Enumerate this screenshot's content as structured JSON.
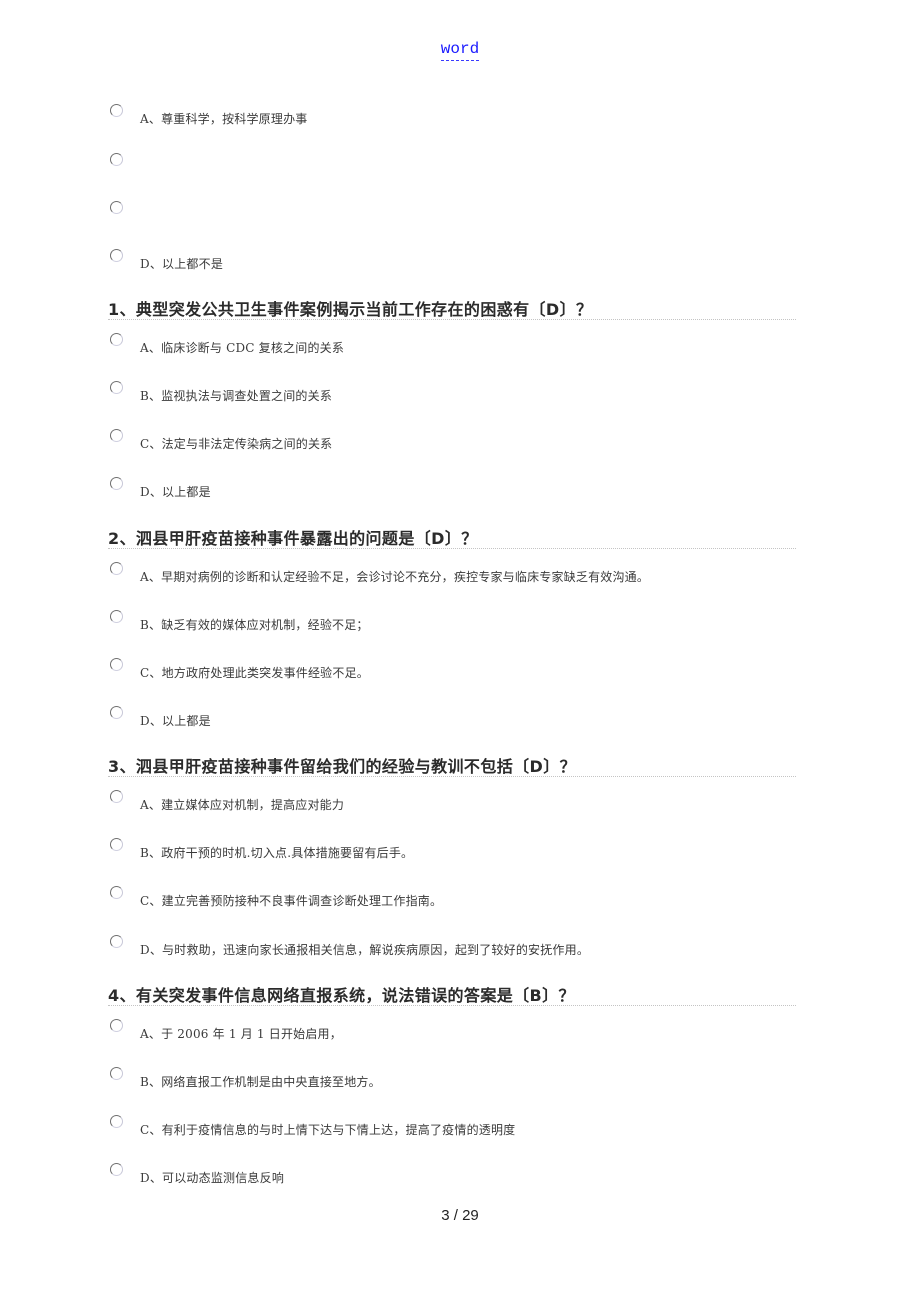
{
  "header": {
    "link_text": "word",
    "link_color": "#1a1aff"
  },
  "icons": {
    "option_marker": "radio-button-icon"
  },
  "preceding_options": [
    {
      "label": "A、尊重科学，按科学原理办事"
    },
    {
      "label": ""
    },
    {
      "label": ""
    },
    {
      "label": "D、以上都不是"
    }
  ],
  "questions": [
    {
      "title": "1、典型突发公共卫生事件案例揭示当前工作存在的困惑有〔D〕？",
      "options": [
        {
          "label": "A、临床诊断与 CDC 复核之间的关系"
        },
        {
          "label": "B、监视执法与调查处置之间的关系"
        },
        {
          "label": "C、法定与非法定传染病之间的关系"
        },
        {
          "label": "D、以上都是"
        }
      ]
    },
    {
      "title": "2、泗县甲肝疫苗接种事件暴露出的问题是〔D〕？",
      "options": [
        {
          "label": "A、早期对病例的诊断和认定经验不足，会诊讨论不充分，疾控专家与临床专家缺乏有效沟通。"
        },
        {
          "label": "B、缺乏有效的媒体应对机制，经验不足；"
        },
        {
          "label": "C、地方政府处理此类突发事件经验不足。"
        },
        {
          "label": "D、以上都是"
        }
      ]
    },
    {
      "title": "3、泗县甲肝疫苗接种事件留给我们的经验与教训不包括〔D〕？",
      "options": [
        {
          "label": "A、建立媒体应对机制，提高应对能力"
        },
        {
          "label": "B、政府干预的时机.切入点.具体措施要留有后手。"
        },
        {
          "label": "C、建立完善预防接种不良事件调查诊断处理工作指南。"
        },
        {
          "label": "D、与时救助，迅速向家长通报相关信息，解说疾病原因，起到了较好的安抚作用。"
        }
      ]
    },
    {
      "title": "4、有关突发事件信息网络直报系统，说法错误的答案是〔B〕？",
      "options": [
        {
          "label": "A、于 2006 年 1 月 1 日开始启用，"
        },
        {
          "label": "B、网络直报工作机制是由中央直接至地方。"
        },
        {
          "label": "C、有利于疫情信息的与时上情下达与下情上达，提高了疫情的透明度"
        },
        {
          "label": "D、可以动态监测信息反响"
        }
      ]
    }
  ],
  "footer": {
    "page_indicator": "3  / 29",
    "current_page": 3,
    "total_pages": 29
  }
}
